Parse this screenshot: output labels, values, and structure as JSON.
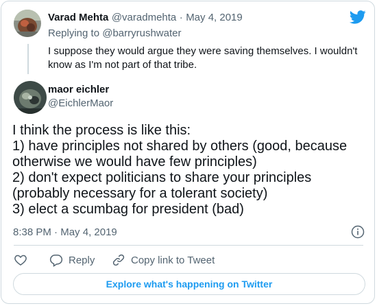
{
  "reply_tweet": {
    "author_name": "Varad Mehta",
    "author_handle": "@varadmehta",
    "separator": "·",
    "date": "May 4, 2019",
    "replying_to_prefix": "Replying to",
    "replying_to_handle": "@barryrushwater",
    "text": "I suppose they would argue they were saving themselves. I wouldn't know as I'm not part of that tribe."
  },
  "main_tweet": {
    "author_name": "maor eichler",
    "author_handle": "@EichlerMaor",
    "text": "I think the process is like this:\n1) have principles not shared by others (good, because otherwise we would have few principles)\n2) don't expect politicians to share your principles (probably necessary for a tolerant society)\n3) elect a scumbag for president (bad)",
    "time": "8:38 PM",
    "separator": "·",
    "date": "May 4, 2019"
  },
  "actions": {
    "like_icon": "heart-icon",
    "reply_label": "Reply",
    "copy_link_label": "Copy link to Tweet"
  },
  "explore_label": "Explore what's happening on Twitter",
  "colors": {
    "twitter_blue": "#1d9bf0",
    "text_primary": "#0f1419",
    "text_secondary": "#536471",
    "border": "#cfd9de"
  }
}
